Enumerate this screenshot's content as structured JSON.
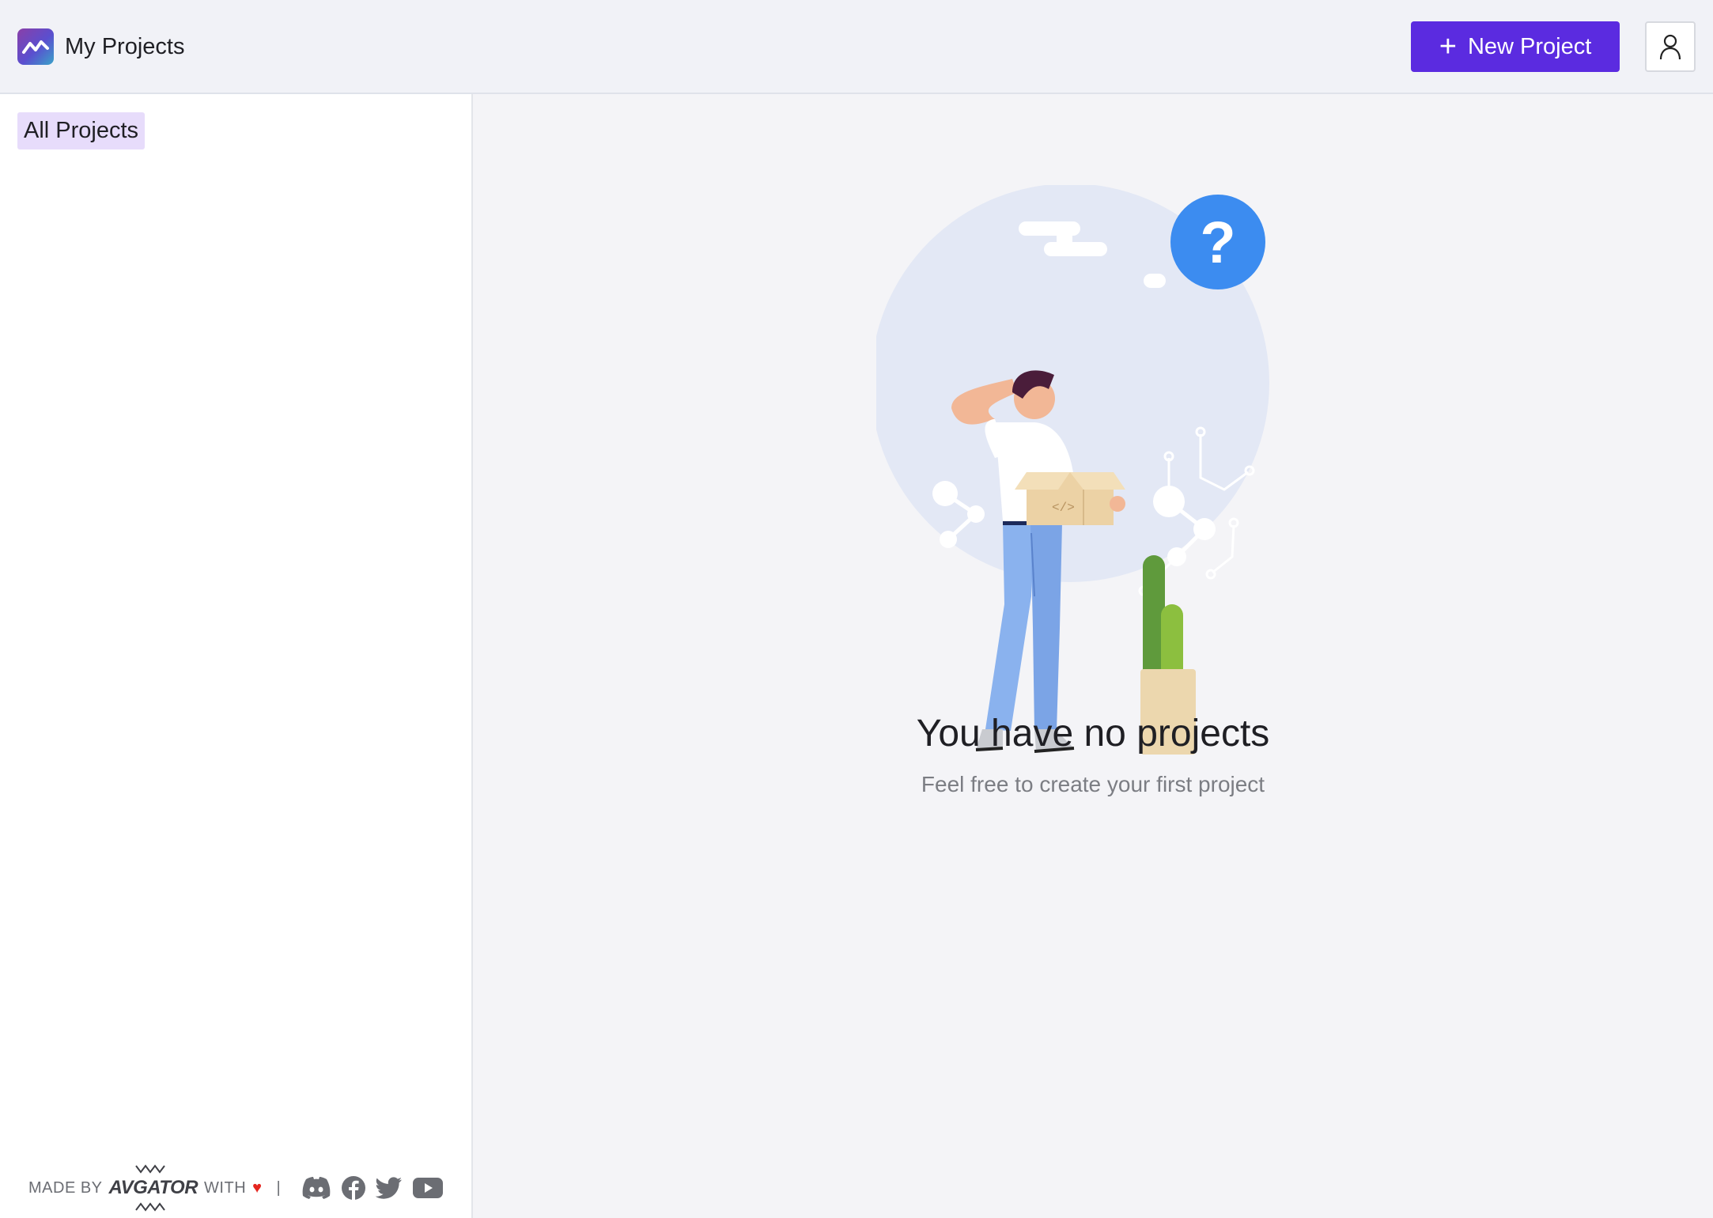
{
  "header": {
    "app_title": "My Projects",
    "logo_icon": "logo-icon",
    "new_project_label": "New Project",
    "new_project_icon": "plus-icon",
    "user_icon": "user-icon"
  },
  "sidebar": {
    "items": [
      {
        "label": "All Projects",
        "active": true
      }
    ]
  },
  "main": {
    "empty_title": "You have no projects",
    "empty_subtitle": "Feel free to create your first project"
  },
  "footer": {
    "made_by": "MADE BY",
    "brand": "AVGATOR",
    "with": "WITH",
    "separator": "|",
    "social_icons": [
      "discord-icon",
      "facebook-icon",
      "twitter-icon",
      "youtube-icon"
    ]
  },
  "colors": {
    "accent": "#5b2be0",
    "active_nav_bg": "#e7dcfb",
    "header_bg": "#f1f2f7",
    "heart": "#e5251f"
  }
}
